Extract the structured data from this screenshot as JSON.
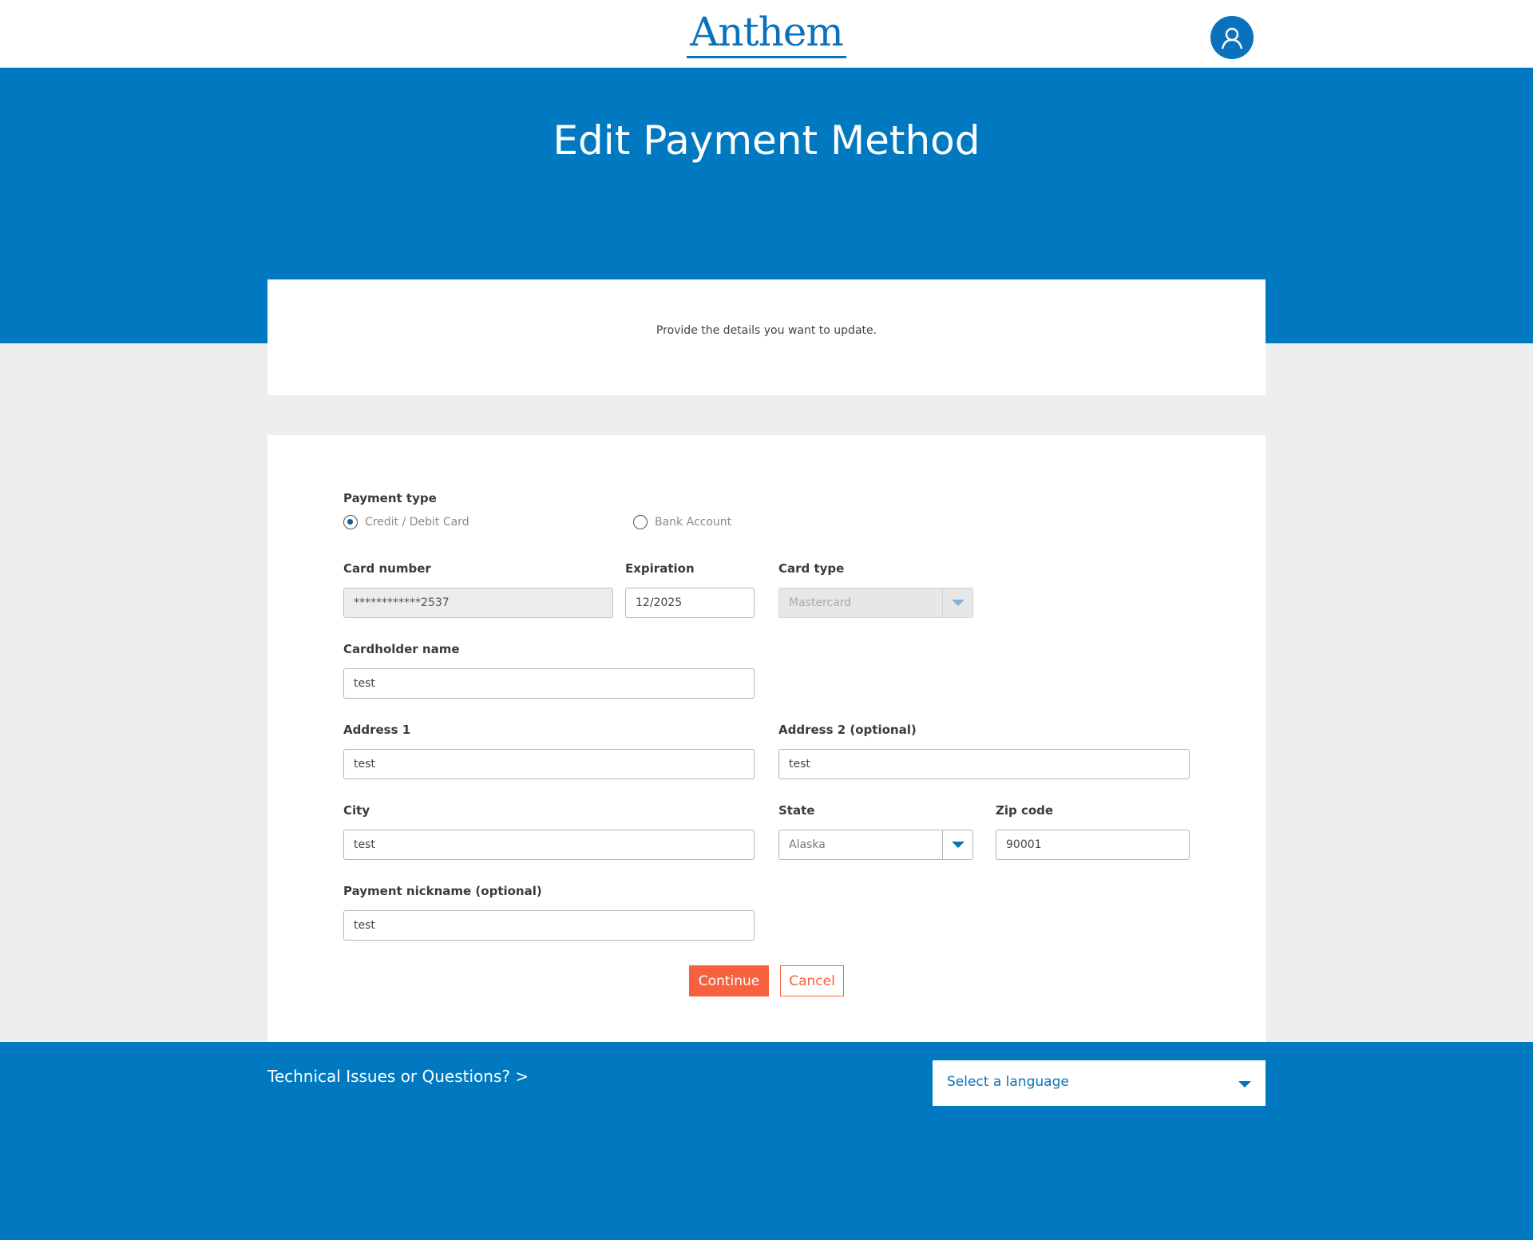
{
  "header": {
    "logo_text": "Anthem",
    "logo_mark": "®",
    "user_icon": "user-icon"
  },
  "hero": {
    "title": "Edit Payment Method"
  },
  "intro": {
    "text": "Provide the details you want to update."
  },
  "form": {
    "payment_type_label": "Payment type",
    "payment_options": [
      {
        "label": "Credit / Debit Card",
        "selected": true
      },
      {
        "label": "Bank Account",
        "selected": false
      }
    ],
    "card_number_label": "Card number",
    "card_number_value": "************2537",
    "expiration_label": "Expiration",
    "expiration_value": "12/2025",
    "card_type_label": "Card type",
    "card_type_value": "Mastercard",
    "cardholder_label": "Cardholder name",
    "cardholder_value": "test",
    "address1_label": "Address 1",
    "address1_value": "test",
    "address2_label": "Address 2 (optional)",
    "address2_value": "test",
    "city_label": "City",
    "city_value": "test",
    "state_label": "State",
    "state_value": "Alaska",
    "zip_label": "Zip code",
    "zip_value": "90001",
    "nickname_label": "Payment nickname (optional)",
    "nickname_value": "test",
    "continue_label": "Continue",
    "cancel_label": "Cancel"
  },
  "footer": {
    "help_link": "Technical Issues or Questions? >",
    "language_placeholder": "Select a language"
  },
  "colors": {
    "brand_blue": "#0179c1",
    "logo_blue": "#0a72bd",
    "accent_orange": "#f76140"
  }
}
